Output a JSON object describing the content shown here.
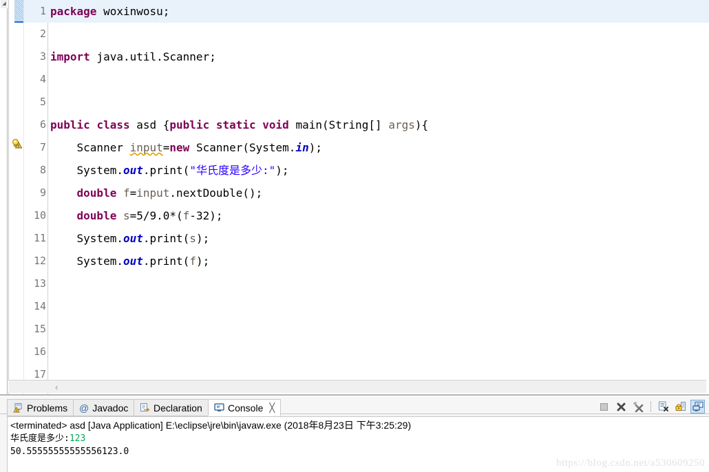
{
  "editor": {
    "line_count": 17,
    "current_line": 1,
    "fold_marker_line": 6,
    "warning_marker_line": 7,
    "warning_icon": "lightbulb-warning-icon",
    "fold_icon": "collapse-minus-icon",
    "hscroll_arrow": "‹",
    "left_strip_arrow": "◢",
    "line_numbers": [
      "1",
      "2",
      "3",
      "4",
      "5",
      "6",
      "7",
      "8",
      "9",
      "10",
      "11",
      "12",
      "13",
      "14",
      "15",
      "16",
      "17"
    ],
    "lines": [
      {
        "n": 1,
        "tokens": [
          {
            "t": "package",
            "c": "kw"
          },
          {
            "t": " woxinwosu;",
            "c": "plain"
          }
        ]
      },
      {
        "n": 2,
        "tokens": []
      },
      {
        "n": 3,
        "tokens": [
          {
            "t": "import",
            "c": "kw"
          },
          {
            "t": " java.util.Scanner;",
            "c": "plain"
          }
        ]
      },
      {
        "n": 4,
        "tokens": []
      },
      {
        "n": 5,
        "tokens": []
      },
      {
        "n": 6,
        "tokens": [
          {
            "t": "public",
            "c": "kw"
          },
          {
            "t": " ",
            "c": "plain"
          },
          {
            "t": "class",
            "c": "kw"
          },
          {
            "t": " asd {",
            "c": "plain"
          },
          {
            "t": "public",
            "c": "kw"
          },
          {
            "t": " ",
            "c": "plain"
          },
          {
            "t": "static",
            "c": "kw"
          },
          {
            "t": " ",
            "c": "plain"
          },
          {
            "t": "void",
            "c": "kw"
          },
          {
            "t": " main(String[] ",
            "c": "plain"
          },
          {
            "t": "args",
            "c": "lvar"
          },
          {
            "t": "){",
            "c": "plain"
          }
        ]
      },
      {
        "n": 7,
        "tokens": [
          {
            "t": "    Scanner ",
            "c": "plain"
          },
          {
            "t": "input",
            "c": "squig"
          },
          {
            "t": "=",
            "c": "plain"
          },
          {
            "t": "new",
            "c": "kw"
          },
          {
            "t": " Scanner(System.",
            "c": "plain"
          },
          {
            "t": "in",
            "c": "fld"
          },
          {
            "t": ");",
            "c": "plain"
          }
        ]
      },
      {
        "n": 8,
        "tokens": [
          {
            "t": "    System.",
            "c": "plain"
          },
          {
            "t": "out",
            "c": "fld"
          },
          {
            "t": ".print(",
            "c": "plain"
          },
          {
            "t": "\"华氏度是多少:\"",
            "c": "str"
          },
          {
            "t": ");",
            "c": "plain"
          }
        ]
      },
      {
        "n": 9,
        "tokens": [
          {
            "t": "    ",
            "c": "plain"
          },
          {
            "t": "double",
            "c": "kw"
          },
          {
            "t": " ",
            "c": "plain"
          },
          {
            "t": "f",
            "c": "lvar"
          },
          {
            "t": "=",
            "c": "plain"
          },
          {
            "t": "input",
            "c": "lvar"
          },
          {
            "t": ".nextDouble();",
            "c": "plain"
          }
        ]
      },
      {
        "n": 10,
        "tokens": [
          {
            "t": "    ",
            "c": "plain"
          },
          {
            "t": "double",
            "c": "kw"
          },
          {
            "t": " ",
            "c": "plain"
          },
          {
            "t": "s",
            "c": "lvar"
          },
          {
            "t": "=5/9.0*(",
            "c": "plain"
          },
          {
            "t": "f",
            "c": "lvar"
          },
          {
            "t": "-32);",
            "c": "plain"
          }
        ]
      },
      {
        "n": 11,
        "tokens": [
          {
            "t": "    System.",
            "c": "plain"
          },
          {
            "t": "out",
            "c": "fld"
          },
          {
            "t": ".print(",
            "c": "plain"
          },
          {
            "t": "s",
            "c": "lvar"
          },
          {
            "t": ");",
            "c": "plain"
          }
        ]
      },
      {
        "n": 12,
        "tokens": [
          {
            "t": "    System.",
            "c": "plain"
          },
          {
            "t": "out",
            "c": "fld"
          },
          {
            "t": ".print(",
            "c": "plain"
          },
          {
            "t": "f",
            "c": "lvar"
          },
          {
            "t": ");",
            "c": "plain"
          }
        ]
      },
      {
        "n": 13,
        "tokens": []
      },
      {
        "n": 14,
        "tokens": []
      },
      {
        "n": 15,
        "tokens": []
      },
      {
        "n": 16,
        "tokens": []
      },
      {
        "n": 17,
        "tokens": []
      }
    ]
  },
  "panel": {
    "tabs": [
      {
        "label": "Problems",
        "icon": "problems-icon",
        "active": false,
        "closable": false
      },
      {
        "label": "Javadoc",
        "icon": "javadoc-at-icon",
        "active": false,
        "closable": false
      },
      {
        "label": "Declaration",
        "icon": "declaration-icon",
        "active": false,
        "closable": false
      },
      {
        "label": "Console",
        "icon": "console-monitor-icon",
        "active": true,
        "closable": true
      }
    ],
    "close_glyph": "╳",
    "toolbar": [
      {
        "name": "terminate-button",
        "icon": "stop-square-icon",
        "enabled": false,
        "pressed": false
      },
      {
        "name": "terminate-all-button",
        "icon": "cross-icon",
        "enabled": true,
        "pressed": false
      },
      {
        "name": "remove-all-terminated-button",
        "icon": "cross-broom-icon",
        "enabled": true,
        "pressed": false
      },
      {
        "name": "clear-console-button",
        "icon": "clear-page-icon",
        "enabled": true,
        "pressed": false
      },
      {
        "name": "scroll-lock-button",
        "icon": "lock-icon",
        "enabled": true,
        "pressed": false
      },
      {
        "name": "display-selected-console-button",
        "icon": "display-console-icon",
        "enabled": true,
        "pressed": true
      }
    ],
    "console": {
      "header": "<terminated> asd [Java Application] E:\\eclipse\\jre\\bin\\javaw.exe (2018年8月23日 下午3:25:29)",
      "output_lines": [
        {
          "segments": [
            {
              "text": "华氏度是多少:",
              "kind": "stdout"
            },
            {
              "text": "123",
              "kind": "stdin"
            }
          ]
        },
        {
          "segments": [
            {
              "text": "50.55555555555556123.0",
              "kind": "stdout"
            }
          ]
        }
      ]
    }
  },
  "watermark": {
    "text": "https://blog.csdn.net/a530609250"
  },
  "colors": {
    "keyword": "#7f0055",
    "string": "#2a00ff",
    "field": "#0000c0",
    "local_var": "#6a5f52",
    "current_line_bg": "#e9f2fb",
    "stdin_green": "#00aa55",
    "warning_squiggle": "#d9a300"
  }
}
